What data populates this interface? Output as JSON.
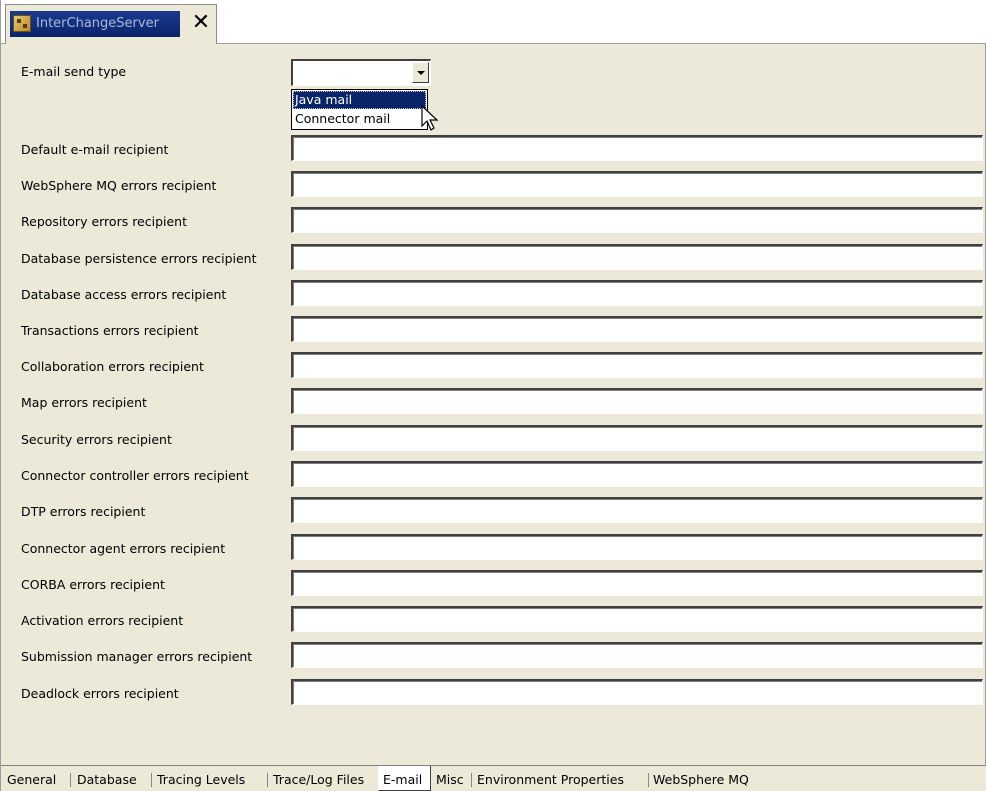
{
  "editor_tab": {
    "title": "InterChangeServer",
    "close": "✕"
  },
  "email_send_type": {
    "label": "E-mail send type",
    "value": "",
    "options": [
      "Java mail",
      "Connector mail"
    ],
    "highlighted_option": "Java mail"
  },
  "fields": [
    {
      "label": "Default e-mail recipient",
      "value": ""
    },
    {
      "label": "WebSphere MQ errors recipient",
      "value": ""
    },
    {
      "label": "Repository errors recipient",
      "value": ""
    },
    {
      "label": "Database persistence errors recipient",
      "value": ""
    },
    {
      "label": "Database access errors recipient",
      "value": ""
    },
    {
      "label": "Transactions errors recipient",
      "value": ""
    },
    {
      "label": "Collaboration errors recipient",
      "value": ""
    },
    {
      "label": "Map errors recipient",
      "value": ""
    },
    {
      "label": "Security errors recipient",
      "value": ""
    },
    {
      "label": "Connector controller errors recipient",
      "value": ""
    },
    {
      "label": "DTP errors recipient",
      "value": ""
    },
    {
      "label": "Connector agent errors recipient",
      "value": ""
    },
    {
      "label": "CORBA errors recipient",
      "value": ""
    },
    {
      "label": "Activation errors recipient",
      "value": ""
    },
    {
      "label": "Submission manager errors recipient",
      "value": ""
    },
    {
      "label": "Deadlock errors recipient",
      "value": ""
    }
  ],
  "bottom_tabs": [
    "General",
    "Database",
    "Tracing Levels",
    "Trace/Log Files",
    "E-mail",
    "Misc",
    "Environment Properties",
    "WebSphere MQ"
  ],
  "active_bottom_tab": "E-mail"
}
